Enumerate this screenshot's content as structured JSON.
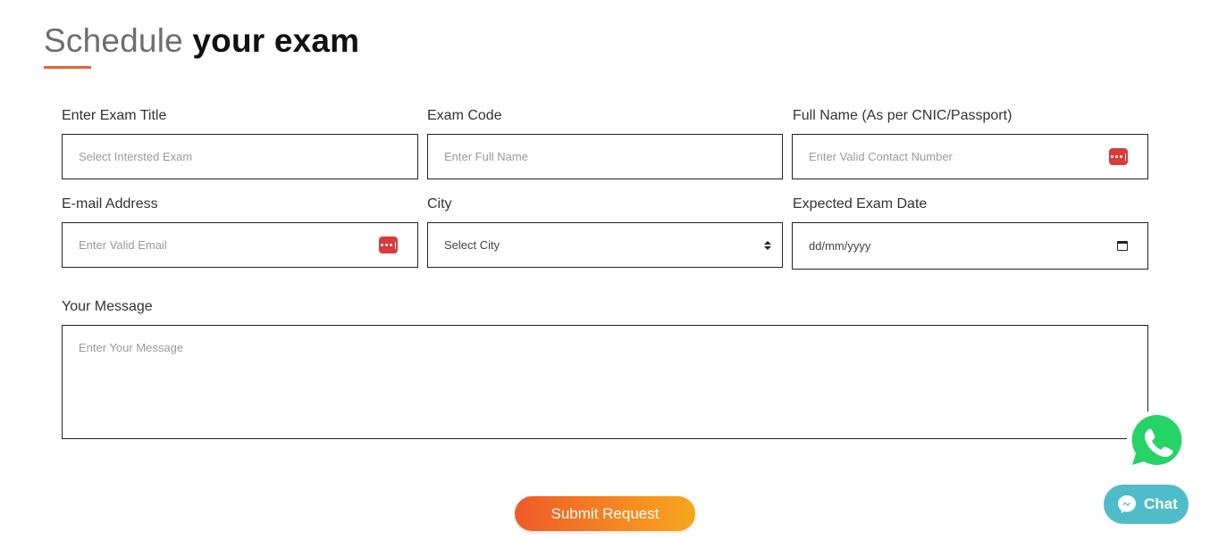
{
  "title": {
    "light": "Schedule",
    "bold": "your exam"
  },
  "fields": {
    "exam_title": {
      "label": "Enter Exam Title",
      "placeholder": "Select Intersted Exam"
    },
    "exam_code": {
      "label": "Exam Code",
      "placeholder": "Enter Full Name"
    },
    "full_name": {
      "label": "Full Name (As per CNIC/Passport)",
      "placeholder": "Enter Valid Contact Number"
    },
    "email": {
      "label": "E-mail Address",
      "placeholder": "Enter Valid Email"
    },
    "city": {
      "label": "City",
      "selected": "Select City"
    },
    "exam_date": {
      "label": "Expected Exam Date",
      "value": "dd/mm/yyyy"
    },
    "message": {
      "label": "Your Message",
      "placeholder": "Enter Your Message"
    }
  },
  "submit_label": "Submit Request",
  "chat_label": "Chat",
  "icons": {
    "password_manager": "password-manager-icon",
    "select_arrows": "select-arrows-icon",
    "calendar": "calendar-icon",
    "whatsapp": "whatsapp-icon",
    "messenger": "messenger-icon"
  },
  "colors": {
    "accent": "#e8632c",
    "chat": "#4fbdc9",
    "whatsapp": "#25d366",
    "pw_icon": "#d93a3a"
  }
}
